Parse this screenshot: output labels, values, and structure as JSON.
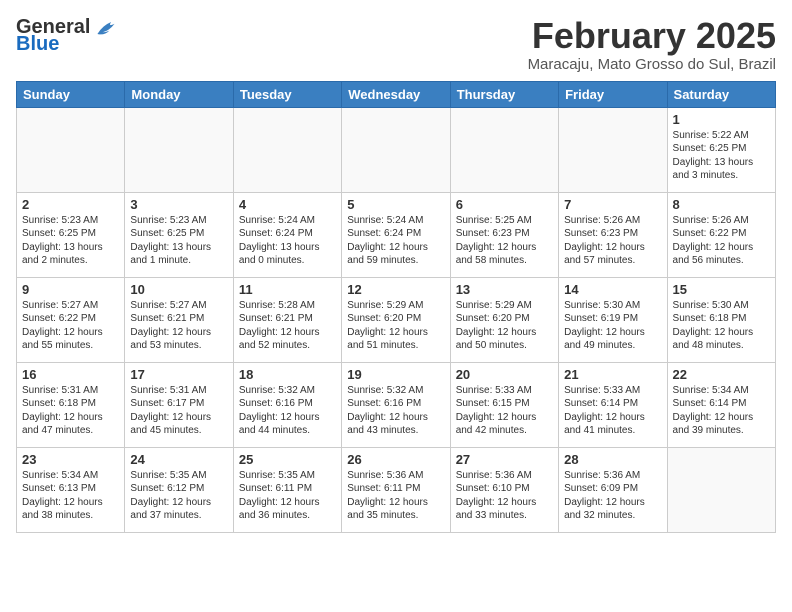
{
  "logo": {
    "general": "General",
    "blue": "Blue"
  },
  "title": "February 2025",
  "location": "Maracaju, Mato Grosso do Sul, Brazil",
  "weekdays": [
    "Sunday",
    "Monday",
    "Tuesday",
    "Wednesday",
    "Thursday",
    "Friday",
    "Saturday"
  ],
  "weeks": [
    [
      {
        "day": "",
        "info": ""
      },
      {
        "day": "",
        "info": ""
      },
      {
        "day": "",
        "info": ""
      },
      {
        "day": "",
        "info": ""
      },
      {
        "day": "",
        "info": ""
      },
      {
        "day": "",
        "info": ""
      },
      {
        "day": "1",
        "info": "Sunrise: 5:22 AM\nSunset: 6:25 PM\nDaylight: 13 hours and 3 minutes."
      }
    ],
    [
      {
        "day": "2",
        "info": "Sunrise: 5:23 AM\nSunset: 6:25 PM\nDaylight: 13 hours and 2 minutes."
      },
      {
        "day": "3",
        "info": "Sunrise: 5:23 AM\nSunset: 6:25 PM\nDaylight: 13 hours and 1 minute."
      },
      {
        "day": "4",
        "info": "Sunrise: 5:24 AM\nSunset: 6:24 PM\nDaylight: 13 hours and 0 minutes."
      },
      {
        "day": "5",
        "info": "Sunrise: 5:24 AM\nSunset: 6:24 PM\nDaylight: 12 hours and 59 minutes."
      },
      {
        "day": "6",
        "info": "Sunrise: 5:25 AM\nSunset: 6:23 PM\nDaylight: 12 hours and 58 minutes."
      },
      {
        "day": "7",
        "info": "Sunrise: 5:26 AM\nSunset: 6:23 PM\nDaylight: 12 hours and 57 minutes."
      },
      {
        "day": "8",
        "info": "Sunrise: 5:26 AM\nSunset: 6:22 PM\nDaylight: 12 hours and 56 minutes."
      }
    ],
    [
      {
        "day": "9",
        "info": "Sunrise: 5:27 AM\nSunset: 6:22 PM\nDaylight: 12 hours and 55 minutes."
      },
      {
        "day": "10",
        "info": "Sunrise: 5:27 AM\nSunset: 6:21 PM\nDaylight: 12 hours and 53 minutes."
      },
      {
        "day": "11",
        "info": "Sunrise: 5:28 AM\nSunset: 6:21 PM\nDaylight: 12 hours and 52 minutes."
      },
      {
        "day": "12",
        "info": "Sunrise: 5:29 AM\nSunset: 6:20 PM\nDaylight: 12 hours and 51 minutes."
      },
      {
        "day": "13",
        "info": "Sunrise: 5:29 AM\nSunset: 6:20 PM\nDaylight: 12 hours and 50 minutes."
      },
      {
        "day": "14",
        "info": "Sunrise: 5:30 AM\nSunset: 6:19 PM\nDaylight: 12 hours and 49 minutes."
      },
      {
        "day": "15",
        "info": "Sunrise: 5:30 AM\nSunset: 6:18 PM\nDaylight: 12 hours and 48 minutes."
      }
    ],
    [
      {
        "day": "16",
        "info": "Sunrise: 5:31 AM\nSunset: 6:18 PM\nDaylight: 12 hours and 47 minutes."
      },
      {
        "day": "17",
        "info": "Sunrise: 5:31 AM\nSunset: 6:17 PM\nDaylight: 12 hours and 45 minutes."
      },
      {
        "day": "18",
        "info": "Sunrise: 5:32 AM\nSunset: 6:16 PM\nDaylight: 12 hours and 44 minutes."
      },
      {
        "day": "19",
        "info": "Sunrise: 5:32 AM\nSunset: 6:16 PM\nDaylight: 12 hours and 43 minutes."
      },
      {
        "day": "20",
        "info": "Sunrise: 5:33 AM\nSunset: 6:15 PM\nDaylight: 12 hours and 42 minutes."
      },
      {
        "day": "21",
        "info": "Sunrise: 5:33 AM\nSunset: 6:14 PM\nDaylight: 12 hours and 41 minutes."
      },
      {
        "day": "22",
        "info": "Sunrise: 5:34 AM\nSunset: 6:14 PM\nDaylight: 12 hours and 39 minutes."
      }
    ],
    [
      {
        "day": "23",
        "info": "Sunrise: 5:34 AM\nSunset: 6:13 PM\nDaylight: 12 hours and 38 minutes."
      },
      {
        "day": "24",
        "info": "Sunrise: 5:35 AM\nSunset: 6:12 PM\nDaylight: 12 hours and 37 minutes."
      },
      {
        "day": "25",
        "info": "Sunrise: 5:35 AM\nSunset: 6:11 PM\nDaylight: 12 hours and 36 minutes."
      },
      {
        "day": "26",
        "info": "Sunrise: 5:36 AM\nSunset: 6:11 PM\nDaylight: 12 hours and 35 minutes."
      },
      {
        "day": "27",
        "info": "Sunrise: 5:36 AM\nSunset: 6:10 PM\nDaylight: 12 hours and 33 minutes."
      },
      {
        "day": "28",
        "info": "Sunrise: 5:36 AM\nSunset: 6:09 PM\nDaylight: 12 hours and 32 minutes."
      },
      {
        "day": "",
        "info": ""
      }
    ]
  ]
}
